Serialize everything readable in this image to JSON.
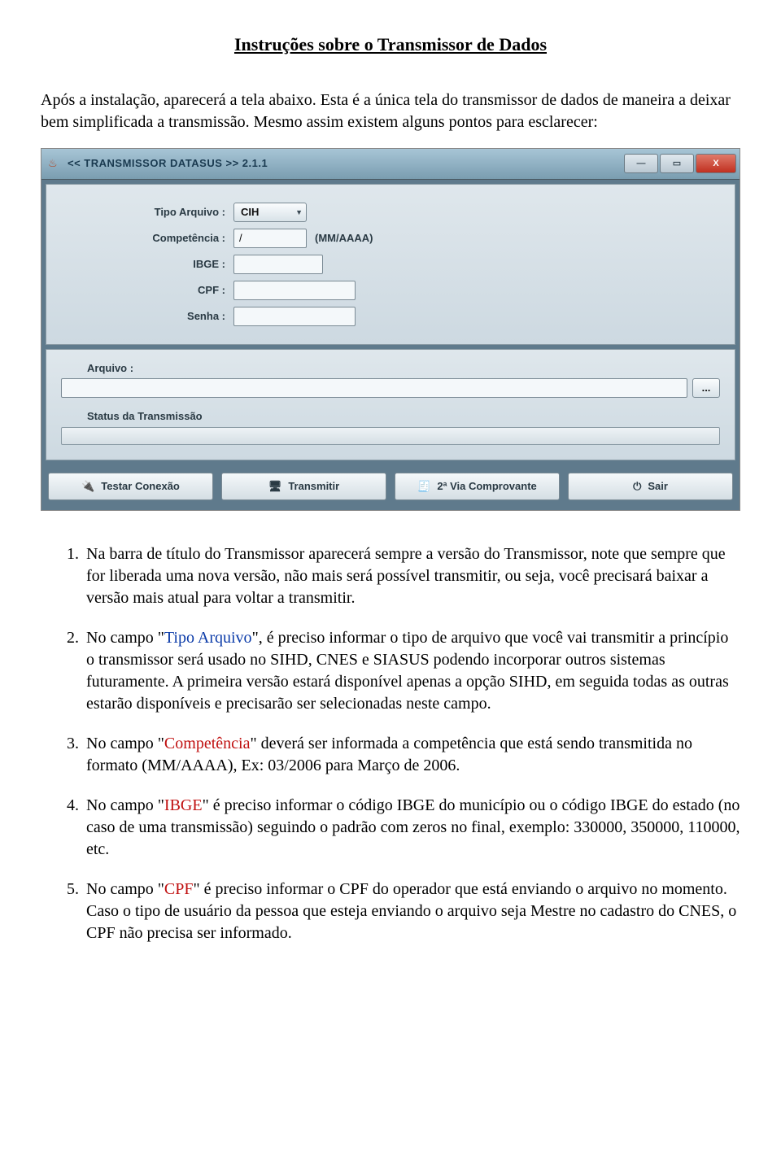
{
  "page": {
    "title": "Instruções sobre o Transmissor de Dados",
    "intro": "Após a instalação, aparecerá a tela abaixo. Esta é a única tela do transmissor de dados de maneira a deixar bem simplificada a transmissão. Mesmo assim existem alguns pontos para esclarecer:"
  },
  "window": {
    "title": "<< TRANSMISSOR DATASUS >>  2.1.1",
    "controls": {
      "minimize": "—",
      "maximize": "▭",
      "close": "X"
    },
    "form": {
      "tipo_arquivo": {
        "label": "Tipo Arquivo :",
        "value": "CIH"
      },
      "competencia": {
        "label": "Competência :",
        "value": "/",
        "hint": "(MM/AAAA)"
      },
      "ibge": {
        "label": "IBGE :",
        "value": ""
      },
      "cpf": {
        "label": "CPF :",
        "value": ""
      },
      "senha": {
        "label": "Senha :",
        "value": ""
      }
    },
    "file": {
      "arquivo_label": "Arquivo :",
      "arquivo_value": "",
      "browse": "...",
      "status_label": "Status da Transmissão"
    },
    "buttons": {
      "testar": "Testar Conexão",
      "transmitir": "Transmitir",
      "segunda_via": "2ª Via Comprovante",
      "sair": "Sair"
    }
  },
  "notes": {
    "n1": "Na barra de título do Transmissor aparecerá sempre a versão do Transmissor, note que sempre que for liberada uma nova versão, não mais será possível transmitir, ou seja, você precisará baixar a versão mais atual para voltar a transmitir.",
    "n2_a": "No campo \"",
    "n2_kw": "Tipo Arquivo",
    "n2_b": "\", é preciso informar o tipo de arquivo que você vai transmitir a princípio o transmissor será usado no SIHD, CNES e SIASUS podendo incorporar outros sistemas futuramente. A primeira versão estará disponível apenas a opção SIHD, em seguida todas as outras estarão disponíveis e precisarão ser selecionadas neste campo.",
    "n3_a": "No campo \"",
    "n3_kw": "Competência",
    "n3_b": "\" deverá ser informada a competência que está sendo transmitida no formato (MM/AAAA), Ex: 03/2006 para Março de 2006.",
    "n4_a": "No campo \"",
    "n4_kw": "IBGE",
    "n4_b": "\" é preciso informar o código IBGE do município ou o código IBGE do estado (no caso de uma transmissão) seguindo o padrão com zeros no final, exemplo: 330000, 350000, 110000, etc.",
    "n5_a": "No campo \"",
    "n5_kw": "CPF",
    "n5_b": "\" é preciso informar o CPF do operador que está enviando o arquivo no momento. Caso o tipo de usuário da pessoa que esteja enviando o arquivo seja Mestre no cadastro do CNES, o CPF não precisa ser informado."
  }
}
